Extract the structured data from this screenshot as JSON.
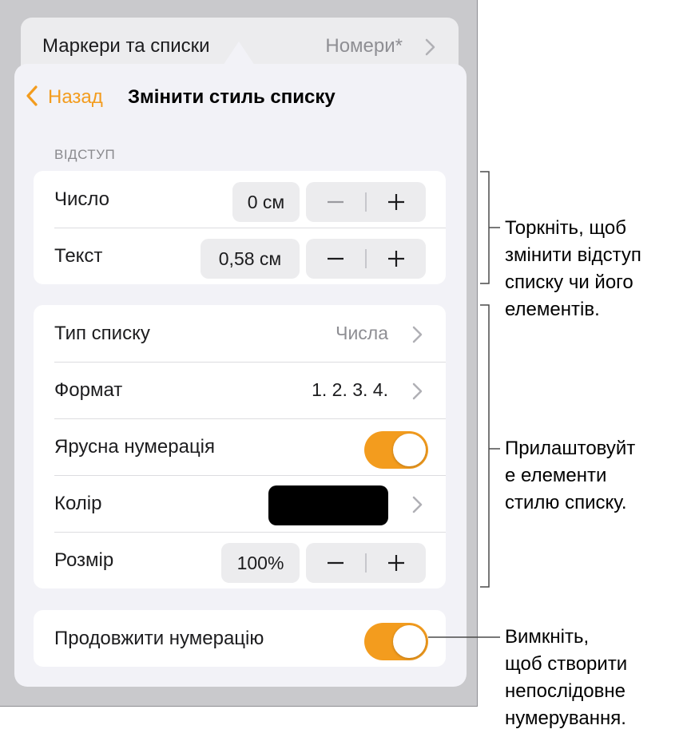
{
  "background_row": {
    "label": "Маркери та списки",
    "value": "Номери*"
  },
  "popover": {
    "nav": {
      "back_label": "Назад",
      "title": "Змінити стиль списку"
    },
    "indent_section": {
      "header": "ВІДСТУП",
      "rows": [
        {
          "label": "Число",
          "value": "0 см"
        },
        {
          "label": "Текст",
          "value": "0,58 см"
        }
      ]
    },
    "style_section": {
      "list_type": {
        "label": "Тип списку",
        "value": "Числа"
      },
      "format": {
        "label": "Формат",
        "value": "1. 2. 3. 4."
      },
      "tiered": {
        "label": "Ярусна нумерація",
        "on": true
      },
      "color": {
        "label": "Колір",
        "swatch": "#000000"
      },
      "size": {
        "label": "Розмір",
        "value": "100%"
      }
    },
    "continue_section": {
      "label": "Продовжити нумерацію",
      "on": true
    }
  },
  "callouts": {
    "indent": "Торкніть, щоб\nзмінити відступ\nсписку чи його\nелементів.",
    "style": "Прилаштовуйт\nе елементи\nстилю списку.",
    "continue": "Вимкніть,\nщоб створити\nнепослідовне\nнумерування."
  },
  "colors": {
    "accent": "#f39c1e",
    "toggle_on": "#f39c1e",
    "swatch": "#000000"
  }
}
